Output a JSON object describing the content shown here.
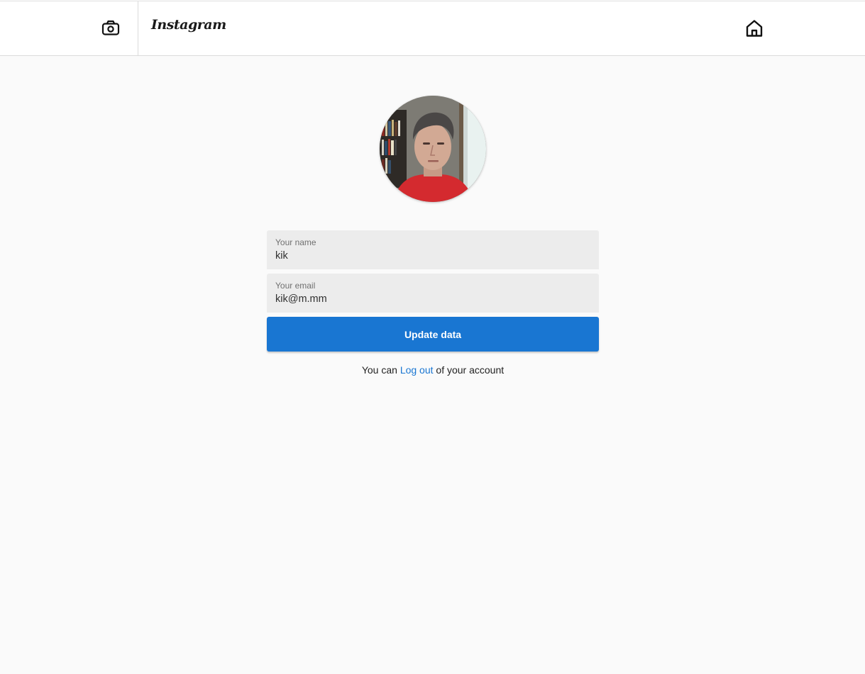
{
  "header": {
    "logo_text": "Instagram",
    "camera_icon": "camera-icon",
    "home_icon": "home-icon"
  },
  "profile": {
    "avatar_alt": "profile-photo"
  },
  "form": {
    "name_label": "Your name",
    "name_value": "kik",
    "email_label": "Your email",
    "email_value": "kik@m.mm",
    "submit_label": "Update data"
  },
  "footer": {
    "logout_prefix": "You can",
    "logout_link": "Log out",
    "logout_suffix": "of your account"
  },
  "colors": {
    "accent": "#1976d2",
    "page_background": "#fafafa",
    "field_background": "#ececec"
  }
}
